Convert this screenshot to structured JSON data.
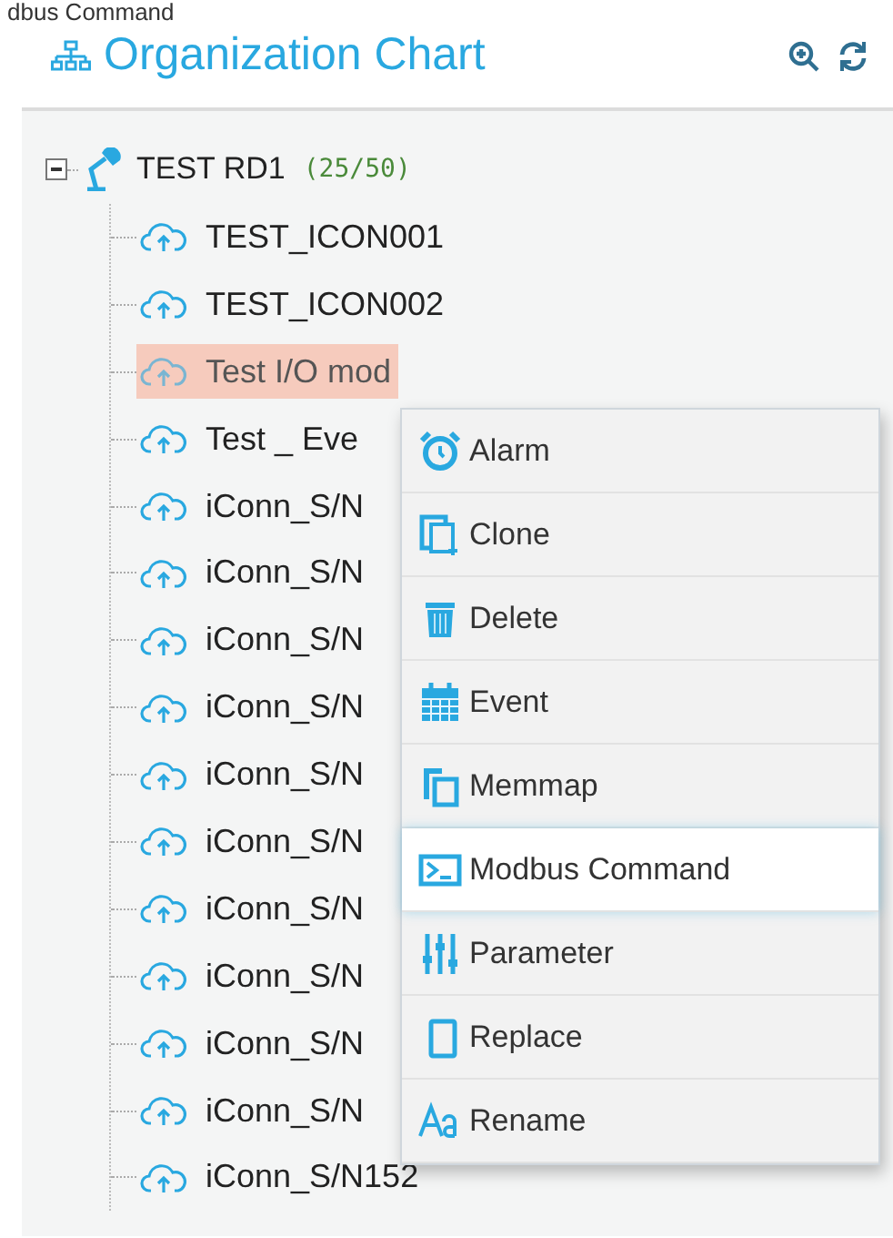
{
  "tooltip_fragment": "dbus Command",
  "header": {
    "title": "Organization Chart"
  },
  "tree": {
    "label": "TEST RD1",
    "count": "(25/50)",
    "expanded": true,
    "children": [
      {
        "label": "TEST_ICON001",
        "selected": false
      },
      {
        "label": "TEST_ICON002",
        "selected": false
      },
      {
        "label": "Test I/O mod",
        "selected": true
      },
      {
        "label": "Test _ Eve",
        "selected": false
      },
      {
        "label": "iConn_S/N",
        "selected": false
      },
      {
        "label": "iConn_S/N",
        "selected": false
      },
      {
        "label": "iConn_S/N",
        "selected": false
      },
      {
        "label": "iConn_S/N",
        "selected": false
      },
      {
        "label": "iConn_S/N",
        "selected": false
      },
      {
        "label": "iConn_S/N",
        "selected": false
      },
      {
        "label": "iConn_S/N",
        "selected": false
      },
      {
        "label": "iConn_S/N",
        "selected": false
      },
      {
        "label": "iConn_S/N",
        "selected": false
      },
      {
        "label": "iConn_S/N",
        "selected": false
      },
      {
        "label": "iConn_S/N152",
        "selected": false
      }
    ]
  },
  "context_menu": [
    {
      "kind": "alarm",
      "label": "Alarm",
      "selected": false
    },
    {
      "kind": "clone",
      "label": "Clone",
      "selected": false
    },
    {
      "kind": "delete",
      "label": "Delete",
      "selected": false
    },
    {
      "kind": "event",
      "label": "Event",
      "selected": false
    },
    {
      "kind": "memmap",
      "label": "Memmap",
      "selected": false
    },
    {
      "kind": "modbus",
      "label": "Modbus Command",
      "selected": true
    },
    {
      "kind": "parameter",
      "label": "Parameter",
      "selected": false
    },
    {
      "kind": "replace",
      "label": "Replace",
      "selected": false
    },
    {
      "kind": "rename",
      "label": "Rename",
      "selected": false
    }
  ]
}
